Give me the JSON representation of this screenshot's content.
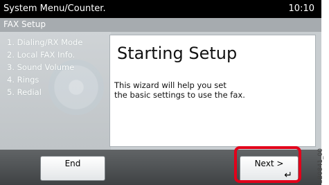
{
  "header": {
    "title": "System Menu/Counter.",
    "time": "10:10"
  },
  "subheader": {
    "title": "FAX Setup"
  },
  "steps": [
    "1. Dialing/RX Mode",
    "2. Local FAX Info.",
    "3. Sound Volume",
    "4. Rings",
    "5. Redial"
  ],
  "content": {
    "title": "Starting Setup",
    "description_line1": "This wizard will help you set",
    "description_line2": "the basic settings to use the fax."
  },
  "buttons": {
    "end_label": "End",
    "next_label": "Next >",
    "enter_glyph": "↵"
  },
  "image_code": "GB0841_00"
}
